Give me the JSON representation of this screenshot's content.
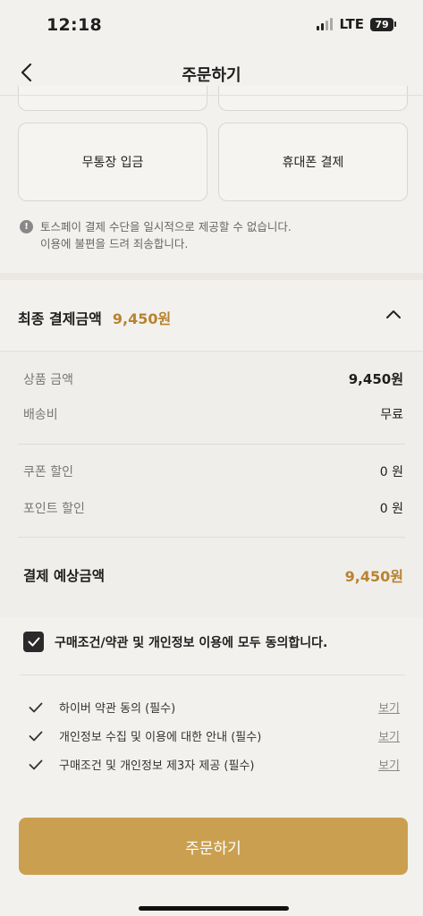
{
  "status_bar": {
    "time": "12:18",
    "network": "LTE",
    "battery": "79"
  },
  "nav": {
    "title": "주문하기"
  },
  "payment_methods": [
    {
      "label": "무통장 입금"
    },
    {
      "label": "휴대폰 결제"
    }
  ],
  "notice": {
    "line1": "토스페이 결제 수단을 일시적으로 제공할 수 없습니다.",
    "line2": "이용에 불편을 드려 죄송합니다."
  },
  "summary": {
    "label": "최종 결제금액",
    "amount": "9,450원",
    "rows": [
      {
        "label": "상품 금액",
        "value": "9,450원"
      },
      {
        "label": "배송비",
        "value": "무료"
      },
      {
        "label": "쿠폰 할인",
        "value": "0 원"
      },
      {
        "label": "포인트 할인",
        "value": "0 원"
      }
    ],
    "total_label": "결제 예상금액",
    "total_value": "9,450원"
  },
  "agreement": {
    "all_label": "구매조건/약관 및 개인정보 이용에 모두 동의합니다.",
    "terms": [
      {
        "label": "하이버 약관 동의 (필수)",
        "view": "보기"
      },
      {
        "label": "개인정보 수집 및 이용에 대한 안내 (필수)",
        "view": "보기"
      },
      {
        "label": "구매조건 및 개인정보 제3자 제공 (필수)",
        "view": "보기"
      }
    ]
  },
  "order_button": {
    "label": "주문하기"
  },
  "colors": {
    "accent": "#caa050",
    "amount": "#b78330"
  }
}
